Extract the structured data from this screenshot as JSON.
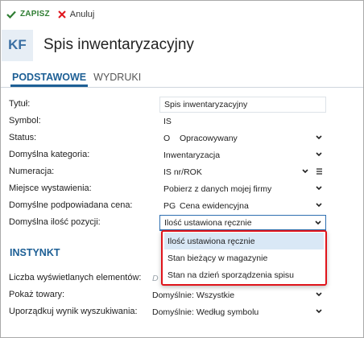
{
  "toolbar": {
    "save_label": "ZAPISZ",
    "cancel_label": "Anuluj"
  },
  "header": {
    "badge": "KF",
    "title": "Spis inwentaryzacyjny"
  },
  "tabs": [
    {
      "label": "PODSTAWOWE",
      "active": true
    },
    {
      "label": "WYDRUKI",
      "active": false
    }
  ],
  "form": {
    "tytul": {
      "label": "Tytuł:",
      "value": "Spis inwentaryzacyjny"
    },
    "symbol": {
      "label": "Symbol:",
      "value": "IS"
    },
    "status": {
      "label": "Status:",
      "code": "O",
      "value": "Opracowywany"
    },
    "kategoria": {
      "label": "Domyślna kategoria:",
      "value": "Inwentaryzacja"
    },
    "numeracja": {
      "label": "Numeracja:",
      "value": "IS nr/ROK"
    },
    "miejsce": {
      "label": "Miejsce wystawienia:",
      "value": "Pobierz z danych mojej firmy"
    },
    "cena": {
      "label": "Domyślne podpowiadana cena:",
      "code": "PG",
      "value": "Cena ewidencyjna"
    },
    "ilosc": {
      "label": "Domyślna ilość pozycji:",
      "value": "Ilość ustawiona ręcznie"
    }
  },
  "dropdown": {
    "options": [
      "Ilość ustawiona ręcznie",
      "Stan bieżący w magazynie",
      "Stan na dzień sporządzenia spisu"
    ],
    "selected_index": 0
  },
  "instynkt": {
    "title": "INSTYNKT",
    "liczba": {
      "label": "Liczba wyświetlanych elementów:",
      "placeholder": "D"
    },
    "towary": {
      "label": "Pokaż towary:",
      "value": "Domyślnie: Wszystkie"
    },
    "wynik": {
      "label": "Uporządkuj wynik wyszukiwania:",
      "value": "Domyślnie: Według symbolu"
    }
  },
  "colors": {
    "accent": "#1d5f95",
    "save_green": "#2e7d32",
    "cancel_red": "#e0141b",
    "dropdown_border": "#e0141b"
  }
}
